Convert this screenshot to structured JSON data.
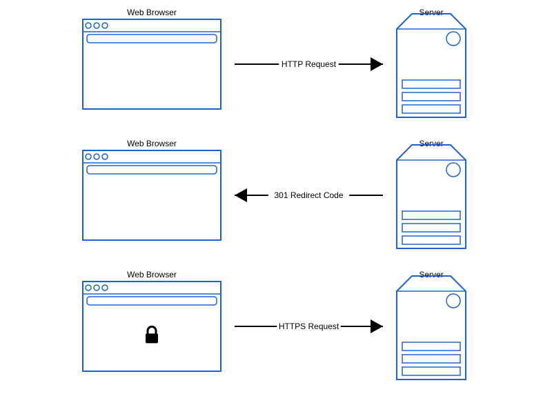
{
  "diagram": {
    "rows": [
      {
        "browser_label": "Web Browser",
        "server_label": "Server",
        "arrow_label": "HTTP Request",
        "direction": "right",
        "secure": false
      },
      {
        "browser_label": "Web Browser",
        "server_label": "Server",
        "arrow_label": "301 Redirect Code",
        "direction": "left",
        "secure": false
      },
      {
        "browser_label": "Web Browser",
        "server_label": "Server",
        "arrow_label": "HTTPS Request",
        "direction": "right",
        "secure": true
      }
    ]
  },
  "colors": {
    "stroke": "#1a63d4",
    "text": "#000000",
    "arrow": "#000000"
  }
}
